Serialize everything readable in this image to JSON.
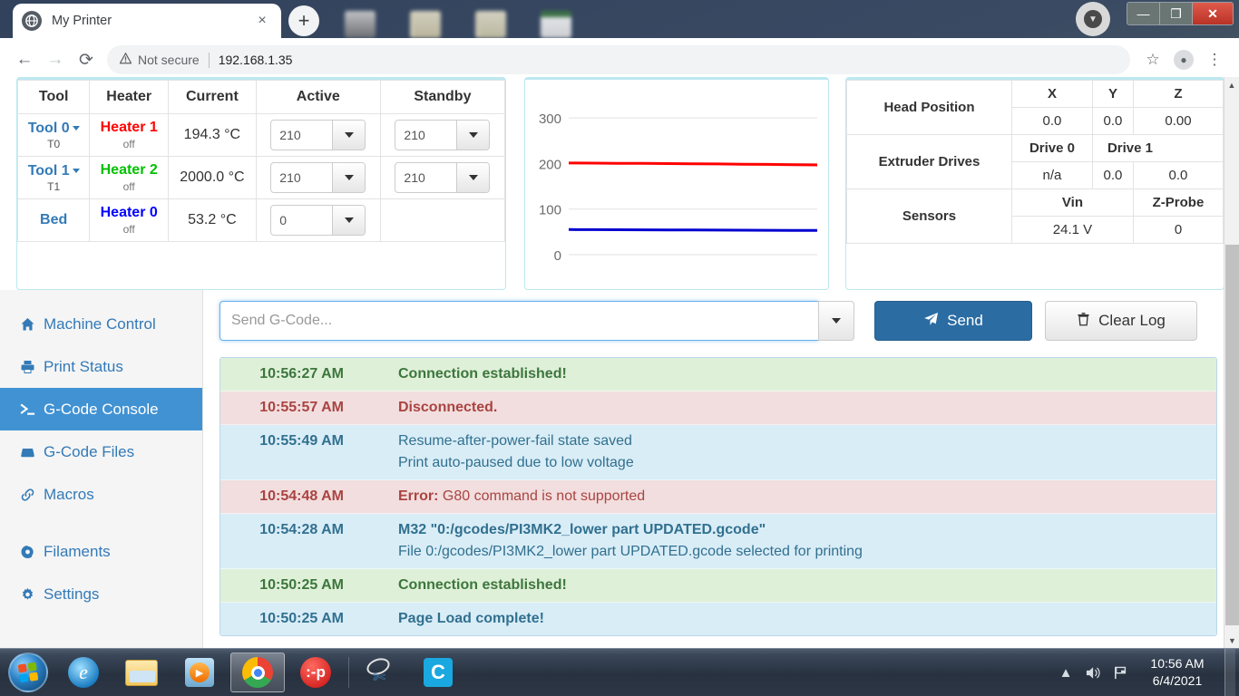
{
  "browser": {
    "tab": {
      "title": "My Printer",
      "favicon": "globe-icon",
      "close": "×"
    },
    "new_tab": "+",
    "nav": {
      "back": "←",
      "forward": "→",
      "reload": "⟳"
    },
    "omnibox": {
      "warning_icon": "⚠",
      "security_label": "Not secure",
      "url": "192.168.1.35"
    },
    "star": "☆",
    "menu": "⋮",
    "window": {
      "minimize": "—",
      "maximize": "❐",
      "close": "✕"
    }
  },
  "tool_table": {
    "headers": [
      "Tool",
      "Heater",
      "Current",
      "Active",
      "Standby"
    ],
    "rows": [
      {
        "tool": "Tool 0",
        "tool_sub": "T0",
        "has_caret": true,
        "heater": "Heater 1",
        "heater_color": "#ff0000",
        "heater_state": "off",
        "current": "194.3 °C",
        "active": "210",
        "standby": "210"
      },
      {
        "tool": "Tool 1",
        "tool_sub": "T1",
        "has_caret": true,
        "heater": "Heater 2",
        "heater_color": "#00c000",
        "heater_state": "off",
        "current": "2000.0 °C",
        "active": "210",
        "standby": "210"
      },
      {
        "tool": "Bed",
        "tool_sub": "",
        "has_caret": false,
        "heater": "Heater 0",
        "heater_color": "#0000ff",
        "heater_state": "off",
        "current": "53.2 °C",
        "active": "0",
        "standby": null
      }
    ]
  },
  "chart_data": {
    "type": "line",
    "title": "",
    "xlabel": "",
    "ylabel": "",
    "ylim": [
      0,
      340
    ],
    "yticks": [
      0,
      100,
      200,
      300
    ],
    "ytick_labels": [
      "0",
      "100",
      "200",
      "300"
    ],
    "grid": true,
    "legend": "none",
    "x": [
      0,
      1,
      2,
      3,
      4,
      5,
      6,
      7,
      8,
      9,
      10
    ],
    "series": [
      {
        "name": "Heater 1",
        "color": "#ff0000",
        "values": [
          201,
          200.8,
          200.5,
          200.2,
          199.8,
          199.4,
          199.0,
          198.5,
          198.0,
          197.4,
          196.8
        ]
      },
      {
        "name": "Heater 0",
        "color": "#0000d0",
        "values": [
          55,
          54.8,
          54.6,
          54.4,
          54.2,
          54.0,
          53.8,
          53.7,
          53.5,
          53.3,
          53.2
        ]
      }
    ]
  },
  "status": {
    "head_position": {
      "label": "Head Position",
      "headers": [
        "X",
        "Y",
        "Z"
      ],
      "values": [
        "0.0",
        "0.0",
        "0.00"
      ]
    },
    "extruder_drives": {
      "label": "Extruder Drives",
      "headers": [
        "Drive 0",
        "Drive 1"
      ],
      "values": [
        "n/a",
        "0.0",
        "0.0"
      ]
    },
    "sensors": {
      "label": "Sensors",
      "headers": [
        "Vin",
        "Z-Probe"
      ],
      "values": [
        "24.1 V",
        "0"
      ]
    }
  },
  "sidebar": {
    "items": [
      {
        "label": "Machine Control",
        "icon": "home-icon",
        "glyph": "⌂",
        "active": false
      },
      {
        "label": "Print Status",
        "icon": "printer-icon",
        "glyph": "⎙",
        "active": false
      },
      {
        "label": "G-Code Console",
        "icon": "terminal-icon",
        "glyph": "≻_",
        "active": true
      },
      {
        "label": "G-Code Files",
        "icon": "drive-icon",
        "glyph": "▬",
        "active": false
      },
      {
        "label": "Macros",
        "icon": "link-icon",
        "glyph": "🔗",
        "active": false
      },
      {
        "label": "Filaments",
        "icon": "spool-icon",
        "glyph": "◉",
        "active": false
      },
      {
        "label": "Settings",
        "icon": "gear-icon",
        "glyph": "⚙",
        "active": false
      }
    ]
  },
  "console": {
    "input_placeholder": "Send G-Code...",
    "input_value": "",
    "dropdown_icon": "chevron-down-icon",
    "send_label": "Send",
    "send_icon": "paper-plane-icon",
    "clear_label": "Clear Log",
    "clear_icon": "trash-icon",
    "log": [
      {
        "time": "10:56:27 AM",
        "type": "success",
        "lines": [
          {
            "text": "Connection established!",
            "bold": true
          }
        ]
      },
      {
        "time": "10:55:57 AM",
        "type": "danger",
        "lines": [
          {
            "text": "Disconnected.",
            "bold": true
          }
        ]
      },
      {
        "time": "10:55:49 AM",
        "type": "info",
        "lines": [
          {
            "text": "Resume-after-power-fail state saved",
            "bold": false
          },
          {
            "text": "Print auto-paused due to low voltage",
            "bold": false
          }
        ]
      },
      {
        "time": "10:54:48 AM",
        "type": "danger",
        "error_prefix": "Error:",
        "lines": [
          {
            "text": "G80 command is not supported",
            "bold": false
          }
        ]
      },
      {
        "time": "10:54:28 AM",
        "type": "info",
        "lines": [
          {
            "text": "M32 \"0:/gcodes/PI3MK2_lower part UPDATED.gcode\"",
            "bold": true
          },
          {
            "text": "File 0:/gcodes/PI3MK2_lower part UPDATED.gcode selected for printing",
            "bold": false
          }
        ]
      },
      {
        "time": "10:50:25 AM",
        "type": "success",
        "lines": [
          {
            "text": "Connection established!",
            "bold": true
          }
        ]
      },
      {
        "time": "10:50:25 AM",
        "type": "info",
        "lines": [
          {
            "text": "Page Load complete!",
            "bold": true
          }
        ]
      }
    ]
  },
  "scrollbar": {
    "up": "▲",
    "down": "▼"
  },
  "taskbar": {
    "start": "windows-orb",
    "items": [
      {
        "name": "internet-explorer",
        "running": false
      },
      {
        "name": "file-explorer",
        "running": false
      },
      {
        "name": "windows-media-player",
        "running": false
      },
      {
        "name": "google-chrome",
        "running": true
      },
      {
        "name": "pronterface",
        "running": false
      },
      {
        "name": "snipping-tool",
        "running": false
      },
      {
        "name": "cura",
        "running": false
      }
    ],
    "tray": {
      "show_hidden": "▲",
      "volume": "🔊",
      "network": "⚑"
    },
    "clock": {
      "time": "10:56 AM",
      "date": "6/4/2021"
    }
  },
  "colors": {
    "accent": "#337ab7",
    "active_nav": "#4192d3",
    "panel_border": "#bce8f1",
    "info": "#d9edf7",
    "success": "#dff0d8",
    "danger": "#f2dede"
  }
}
